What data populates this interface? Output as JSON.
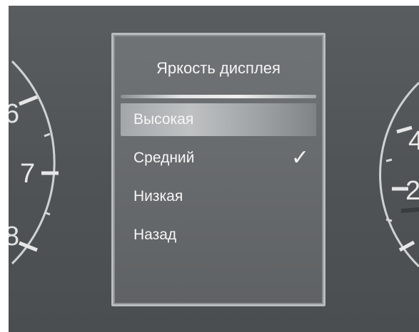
{
  "menu": {
    "title": "Яркость дисплея",
    "items": [
      {
        "label": "Высокая",
        "selected": true,
        "checked": false
      },
      {
        "label": "Средний",
        "selected": false,
        "checked": true
      },
      {
        "label": "Низкая",
        "selected": false,
        "checked": false
      },
      {
        "label": "Назад",
        "selected": false,
        "checked": false
      }
    ]
  },
  "gauges": {
    "left": {
      "labels": [
        "6",
        "7",
        "8"
      ]
    },
    "right": {
      "labels": [
        "4",
        "2"
      ]
    }
  },
  "icons": {
    "check": "check-icon"
  },
  "colors": {
    "screen": "#55595b",
    "panel_border": "#b9bdbf",
    "text": "#f4f4f4"
  }
}
